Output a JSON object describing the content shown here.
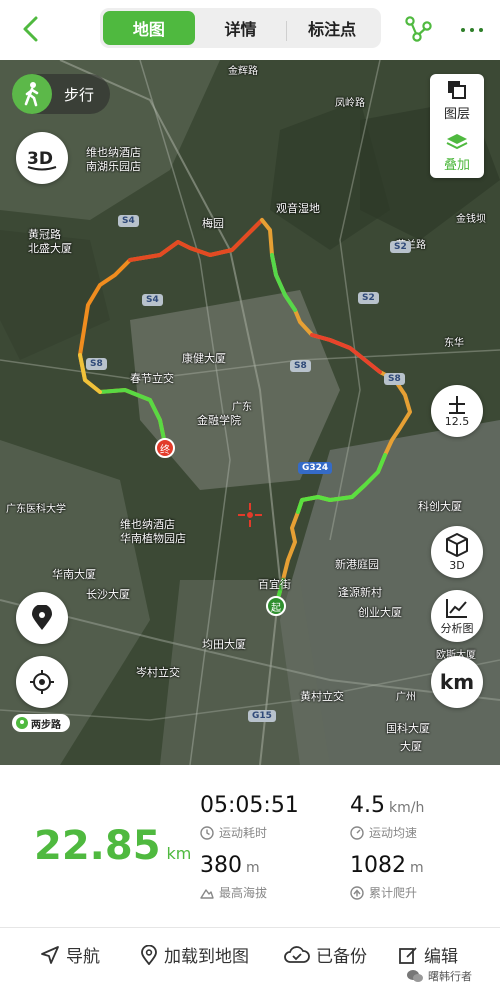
{
  "tabs": {
    "map": "地图",
    "details": "详情",
    "annotations": "标注点"
  },
  "map": {
    "mode_label": "步行",
    "layers_label": "图层",
    "overlay_label": "叠加",
    "btn_3d_label": "3D",
    "zoom_level": "12.5",
    "analysis_label": "分析图",
    "km_label": "km",
    "logo_text": "两步路",
    "start_marker": "起",
    "end_marker": "终",
    "route_badges": [
      "S4",
      "S4",
      "S8",
      "S8",
      "S2",
      "S2",
      "G324",
      "G15",
      "S8"
    ],
    "place_labels": [
      "金辉路",
      "维也纳酒店",
      "南湖乐园店",
      "黄冠路",
      "北盛大厦",
      "梅园",
      "观音湿地",
      "凤岭路",
      "金钱坝",
      "菲兰路",
      "东华",
      "春节立交",
      "康健大厦",
      "广东",
      "金融学院",
      "维也纳酒店",
      "华南植物园店",
      "华南大厦",
      "长沙大厦",
      "百宜街",
      "新港庭园",
      "逢源新村",
      "创业大厦",
      "均田大厦",
      "岑村立交",
      "广东医科大学",
      "科创大厦",
      "黄村立交",
      "大厦",
      "国科大厦",
      "欧斯大厦",
      "广州"
    ]
  },
  "stats": {
    "distance_value": "22.85",
    "distance_unit": "km",
    "duration_value": "05:05:51",
    "duration_label": "运动耗时",
    "avg_speed_value": "4.5",
    "avg_speed_unit": "km/h",
    "avg_speed_label": "运动均速",
    "max_altitude_value": "380",
    "max_altitude_unit": "m",
    "max_altitude_label": "最高海拔",
    "total_climb_value": "1082",
    "total_climb_unit": "m",
    "total_climb_label": "累计爬升"
  },
  "bottom": {
    "navigate": "导航",
    "load_to_map": "加载到地图",
    "backed_up": "已备份",
    "edit": "编辑",
    "watermark": "曙韩行者"
  },
  "colors": {
    "accent": "#4fb93f",
    "route_high": "#e23b2a",
    "route_mid": "#f2d23a",
    "route_low": "#3fd33f"
  }
}
